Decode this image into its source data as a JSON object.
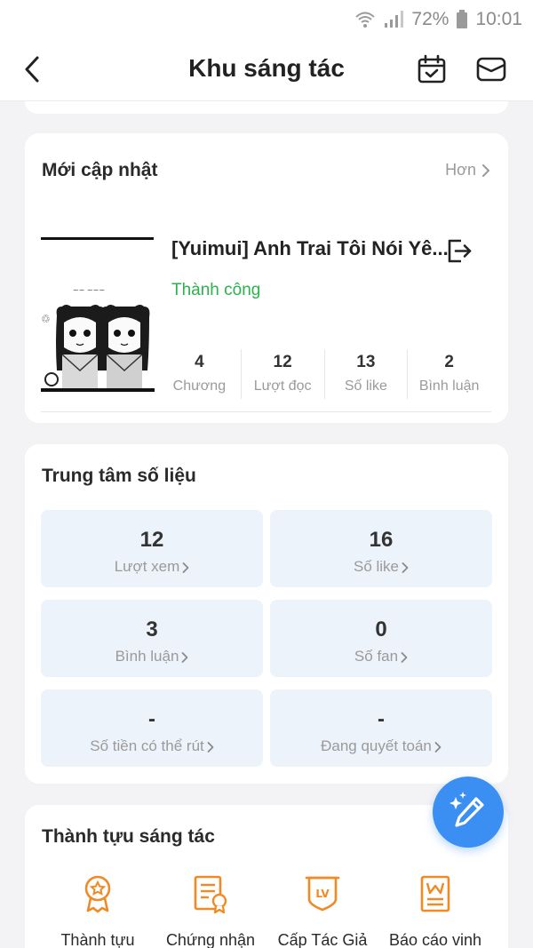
{
  "status_bar": {
    "battery": "72%",
    "time": "10:01"
  },
  "header": {
    "title": "Khu sáng tác"
  },
  "recent": {
    "title": "Mới cập nhật",
    "more": "Hơn",
    "book": {
      "title": "[Yuimui] Anh Trai Tôi Nói Yê...",
      "status": "Thành công",
      "status_color": "#2bb24c",
      "stats": [
        {
          "value": "4",
          "label": "Chương"
        },
        {
          "value": "12",
          "label": "Lượt đọc"
        },
        {
          "value": "13",
          "label": "Số like"
        },
        {
          "value": "2",
          "label": "Bình luận"
        }
      ]
    }
  },
  "data_center": {
    "title": "Trung tâm số liệu",
    "tiles": [
      {
        "value": "12",
        "label": "Lượt xem"
      },
      {
        "value": "16",
        "label": "Số like"
      },
      {
        "value": "3",
        "label": "Bình luận"
      },
      {
        "value": "0",
        "label": "Số fan"
      },
      {
        "value": "-",
        "label": "Số tiền có thể rút"
      },
      {
        "value": "-",
        "label": "Đang quyết toán"
      }
    ]
  },
  "achievements": {
    "title": "Thành tựu sáng tác",
    "items": [
      {
        "label": "Thành tựu",
        "icon": "medal-icon"
      },
      {
        "label": "Chứng nhận",
        "icon": "certificate-icon"
      },
      {
        "label": "Cấp Tác Giả",
        "icon": "level-badge-icon"
      },
      {
        "label": "Báo cáo vinh",
        "icon": "report-icon"
      }
    ],
    "accent": "#f08a24"
  },
  "fab": {
    "icon": "edit-sparkle-icon",
    "color": "#3b8ff3"
  }
}
